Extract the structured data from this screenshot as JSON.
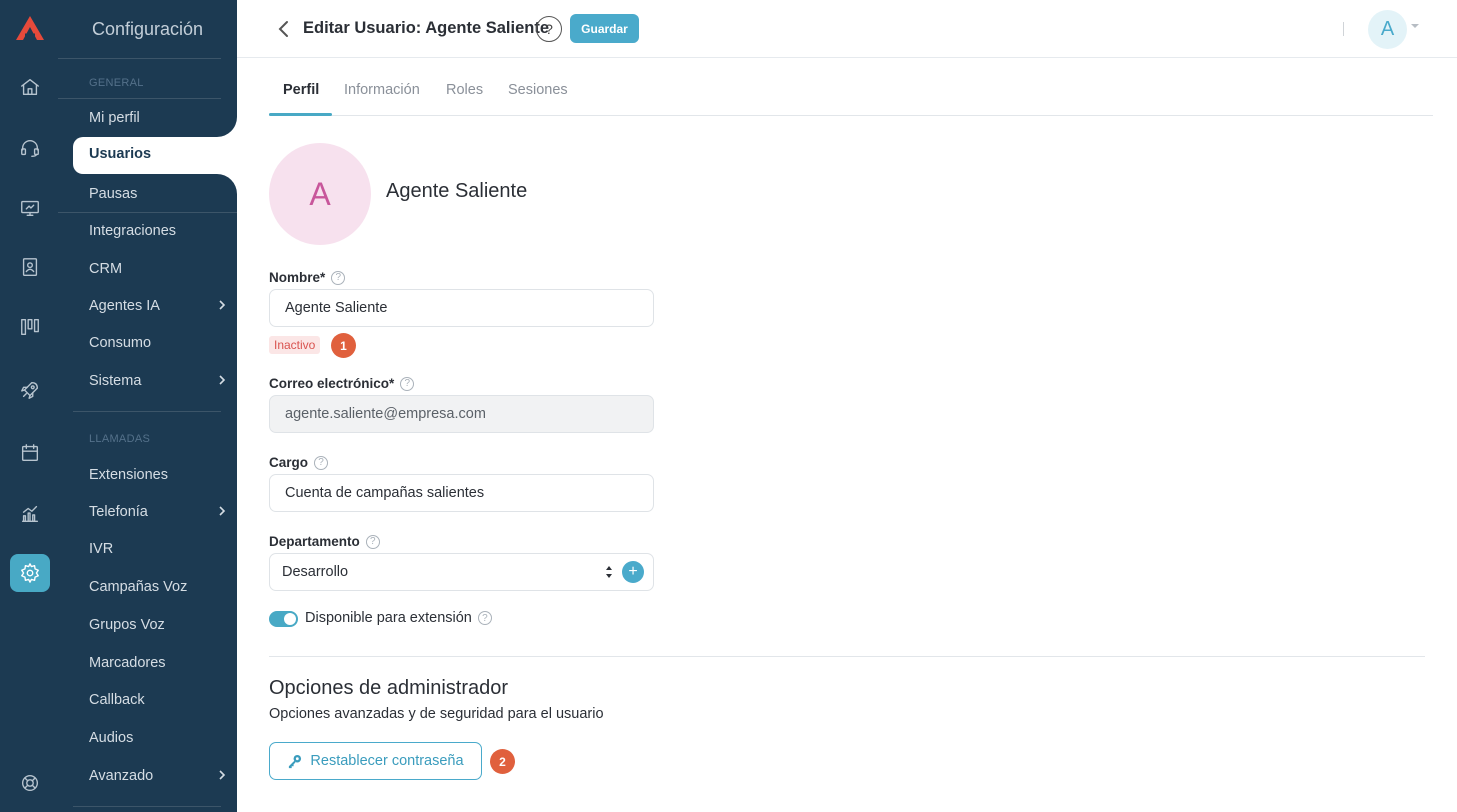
{
  "app": {
    "settings_title": "Configuración"
  },
  "rail": {
    "items": [
      {
        "icon": "home-icon",
        "active": false
      },
      {
        "icon": "headset-icon",
        "active": false
      },
      {
        "icon": "monitor-icon",
        "active": false
      },
      {
        "icon": "contacts-book-icon",
        "active": false
      },
      {
        "icon": "kanban-icon",
        "active": false
      },
      {
        "icon": "rocket-icon",
        "active": false
      },
      {
        "icon": "calendar-icon",
        "active": false
      },
      {
        "icon": "analytics-icon",
        "active": false
      },
      {
        "icon": "gear-icon",
        "active": true
      },
      {
        "icon": "lifebuoy-icon",
        "active": false
      }
    ]
  },
  "sidebar": {
    "section_general": "GENERAL",
    "section_calls": "LLAMADAS",
    "general_items": [
      "Mi perfil",
      "Usuarios",
      "Pausas",
      "Integraciones",
      "CRM",
      "Agentes IA",
      "Consumo",
      "Sistema"
    ],
    "call_items": [
      "Extensiones",
      "Telefonía",
      "IVR",
      "Campañas Voz",
      "Grupos Voz",
      "Marcadores",
      "Callback",
      "Audios",
      "Avanzado"
    ],
    "active_item": "Usuarios"
  },
  "header": {
    "title": "Editar Usuario: Agente Saliente",
    "help": "?",
    "save_label": "Guardar",
    "user_initial": "A"
  },
  "tabs": [
    "Perfil",
    "Información",
    "Roles",
    "Sesiones"
  ],
  "active_tab": "Perfil",
  "profile": {
    "initial": "A",
    "name": "Agente Saliente",
    "nombre_label": "Nombre*",
    "nombre_value": "Agente Saliente",
    "status_badge": "Inactivo",
    "marker_1": "1",
    "email_label": "Correo electrónico*",
    "email_value": "agente.saliente@empresa.com",
    "cargo_label": "Cargo",
    "cargo_value": "Cuenta de campañas salientes",
    "department_label": "Departamento",
    "department_value": "Desarrollo",
    "add_symbol": "+",
    "extension_toggle_label": "Disponible para extensión",
    "extension_toggle_on": true,
    "help_mark": "?"
  },
  "admin": {
    "title": "Opciones de administrador",
    "subtitle": "Opciones avanzadas y de seguridad para el usuario",
    "reset_label": "Restablecer contraseña",
    "marker_2": "2"
  },
  "colors": {
    "sidebar_bg": "#1c3a52",
    "accent": "#48a9c5",
    "avatar_bg": "#f7e1ee",
    "avatar_fg": "#c8569b",
    "danger": "#e0603d"
  }
}
